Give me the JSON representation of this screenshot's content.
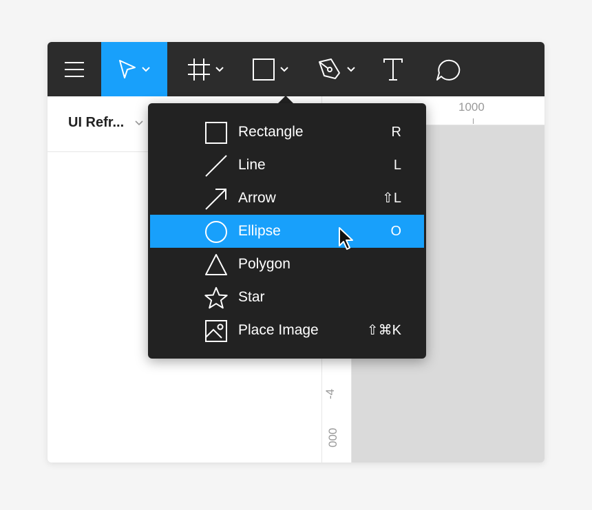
{
  "toolbar": {
    "tools": [
      {
        "name": "menu-icon"
      },
      {
        "name": "move-tool-icon",
        "active": true
      },
      {
        "name": "frame-tool-icon"
      },
      {
        "name": "shape-tool-icon"
      },
      {
        "name": "pen-tool-icon"
      },
      {
        "name": "text-tool-icon"
      },
      {
        "name": "comment-tool-icon"
      }
    ],
    "active_color": "#18a0fb",
    "background_color": "#2c2c2c"
  },
  "layers_panel": {
    "page_name": "UI Refr..."
  },
  "rulers": {
    "horizontal_label": "1000",
    "vertical_label_1": "-4",
    "vertical_label_2": "000"
  },
  "shape_menu": {
    "items": [
      {
        "label": "Rectangle",
        "shortcut": "R",
        "icon": "rectangle-icon"
      },
      {
        "label": "Line",
        "shortcut": "L",
        "icon": "line-icon"
      },
      {
        "label": "Arrow",
        "shortcut": "⇧L",
        "icon": "arrow-icon"
      },
      {
        "label": "Ellipse",
        "shortcut": "O",
        "icon": "ellipse-icon",
        "active": true
      },
      {
        "label": "Polygon",
        "shortcut": "",
        "icon": "polygon-icon"
      },
      {
        "label": "Star",
        "shortcut": "",
        "icon": "star-icon"
      },
      {
        "label": "Place Image",
        "shortcut": "⇧⌘K",
        "icon": "image-icon"
      }
    ],
    "highlight_color": "#18a0fb",
    "background_color": "#222222"
  }
}
